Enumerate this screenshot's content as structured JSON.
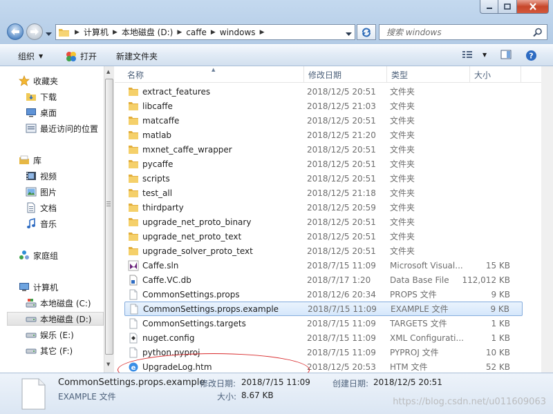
{
  "navbar": {
    "breadcrumb": [
      "计算机",
      "本地磁盘 (D:)",
      "caffe",
      "windows"
    ],
    "search_placeholder": "搜索 windows"
  },
  "toolbar": {
    "organize": "组织",
    "open": "打开",
    "new_folder": "新建文件夹"
  },
  "sidebar": {
    "favorites": "收藏夹",
    "downloads": "下载",
    "desktop": "桌面",
    "recent": "最近访问的位置",
    "libraries": "库",
    "videos": "视频",
    "pictures": "图片",
    "documents": "文档",
    "music": "音乐",
    "homegroup": "家庭组",
    "computer": "计算机",
    "drive_c": "本地磁盘 (C:)",
    "drive_d": "本地磁盘 (D:)",
    "drive_e": "娱乐 (E:)",
    "drive_f": "其它 (F:)"
  },
  "columns": {
    "name": "名称",
    "modified": "修改日期",
    "type": "类型",
    "size": "大小"
  },
  "files": [
    {
      "name": "extract_features",
      "date": "2018/12/5 20:51",
      "type": "文件夹",
      "size": "",
      "icon": "folder-icon"
    },
    {
      "name": "libcaffe",
      "date": "2018/12/5 21:03",
      "type": "文件夹",
      "size": "",
      "icon": "folder-icon"
    },
    {
      "name": "matcaffe",
      "date": "2018/12/5 20:51",
      "type": "文件夹",
      "size": "",
      "icon": "folder-icon"
    },
    {
      "name": "matlab",
      "date": "2018/12/5 21:20",
      "type": "文件夹",
      "size": "",
      "icon": "folder-icon"
    },
    {
      "name": "mxnet_caffe_wrapper",
      "date": "2018/12/5 20:51",
      "type": "文件夹",
      "size": "",
      "icon": "folder-icon"
    },
    {
      "name": "pycaffe",
      "date": "2018/12/5 20:51",
      "type": "文件夹",
      "size": "",
      "icon": "folder-icon"
    },
    {
      "name": "scripts",
      "date": "2018/12/5 20:51",
      "type": "文件夹",
      "size": "",
      "icon": "folder-icon"
    },
    {
      "name": "test_all",
      "date": "2018/12/5 21:18",
      "type": "文件夹",
      "size": "",
      "icon": "folder-icon"
    },
    {
      "name": "thirdparty",
      "date": "2018/12/5 20:59",
      "type": "文件夹",
      "size": "",
      "icon": "folder-icon"
    },
    {
      "name": "upgrade_net_proto_binary",
      "date": "2018/12/5 20:51",
      "type": "文件夹",
      "size": "",
      "icon": "folder-icon"
    },
    {
      "name": "upgrade_net_proto_text",
      "date": "2018/12/5 20:51",
      "type": "文件夹",
      "size": "",
      "icon": "folder-icon"
    },
    {
      "name": "upgrade_solver_proto_text",
      "date": "2018/12/5 20:51",
      "type": "文件夹",
      "size": "",
      "icon": "folder-icon"
    },
    {
      "name": "Caffe.sln",
      "date": "2018/7/15 11:09",
      "type": "Microsoft Visual...",
      "size": "15 KB",
      "icon": "visual-studio-icon"
    },
    {
      "name": "Caffe.VC.db",
      "date": "2018/7/17 1:20",
      "type": "Data Base File",
      "size": "112,012 KB",
      "icon": "database-file-icon"
    },
    {
      "name": "CommonSettings.props",
      "date": "2018/12/6 20:34",
      "type": "PROPS 文件",
      "size": "9 KB",
      "icon": "document-icon"
    },
    {
      "name": "CommonSettings.props.example",
      "date": "2018/7/15 11:09",
      "type": "EXAMPLE 文件",
      "size": "9 KB",
      "icon": "document-icon",
      "selected": true
    },
    {
      "name": "CommonSettings.targets",
      "date": "2018/7/15 11:09",
      "type": "TARGETS 文件",
      "size": "1 KB",
      "icon": "document-icon"
    },
    {
      "name": "nuget.config",
      "date": "2018/7/15 11:09",
      "type": "XML Configurati...",
      "size": "1 KB",
      "icon": "config-file-icon"
    },
    {
      "name": "python.pyproj",
      "date": "2018/7/15 11:09",
      "type": "PYPROJ 文件",
      "size": "10 KB",
      "icon": "document-icon"
    },
    {
      "name": "UpgradeLog.htm",
      "date": "2018/12/5 20:53",
      "type": "HTM 文件",
      "size": "52 KB",
      "icon": "ie-html-icon"
    }
  ],
  "details": {
    "name": "CommonSettings.props.example",
    "type": "EXAMPLE 文件",
    "modified_label": "修改日期:",
    "modified_value": "2018/7/15 11:09",
    "created_label": "创建日期:",
    "created_value": "2018/12/5 20:51",
    "size_label": "大小:",
    "size_value": "8.67 KB",
    "watermark": "https://blog.csdn.net/u011609063"
  },
  "colors": {
    "selection_border": "#84acdd",
    "annotation": "#d8282a",
    "folder": "#f2c94c"
  }
}
